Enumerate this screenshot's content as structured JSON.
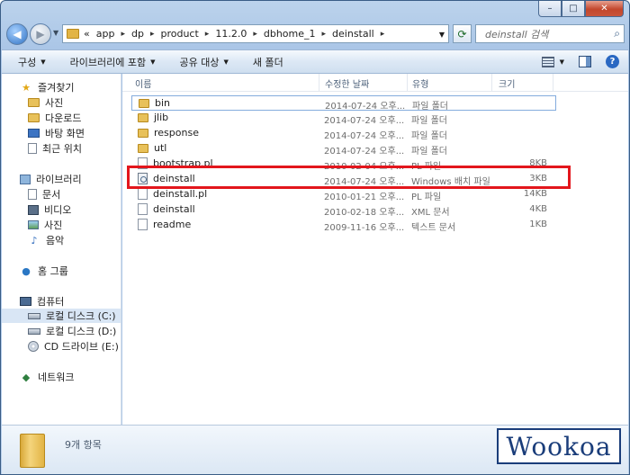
{
  "window": {
    "controls": {
      "minimize": "–",
      "maximize": "□",
      "close": "✕"
    }
  },
  "address_bar": {
    "overflow": "«",
    "crumbs": [
      "app",
      "dp",
      "product",
      "11.2.0",
      "dbhome_1",
      "deinstall"
    ]
  },
  "search": {
    "placeholder": "deinstall 검색"
  },
  "toolbar": {
    "organize": "구성",
    "add_to_library": "라이브러리에 포함",
    "share_with": "공유 대상",
    "new_folder": "새 폴더"
  },
  "sidebar": {
    "favorites": "즐겨찾기",
    "fav_items": [
      "사진",
      "다운로드",
      "바탕 화면",
      "최근 위치"
    ],
    "libraries": "라이브러리",
    "lib_items": [
      "문서",
      "비디오",
      "사진",
      "음악"
    ],
    "homegroup": "홈 그룹",
    "computer": "컴퓨터",
    "drives": [
      "로컬 디스크 (C:)",
      "로컬 디스크 (D:)",
      "CD 드라이브 (E:)"
    ],
    "network": "네트워크"
  },
  "columns": {
    "name": "이름",
    "modified": "수정한 날짜",
    "type": "유형",
    "size": "크기"
  },
  "files": [
    {
      "name": "bin",
      "modified": "2014-07-24 오후...",
      "type": "파일 폴더",
      "size": ""
    },
    {
      "name": "jlib",
      "modified": "2014-07-24 오후...",
      "type": "파일 폴더",
      "size": ""
    },
    {
      "name": "response",
      "modified": "2014-07-24 오후...",
      "type": "파일 폴더",
      "size": ""
    },
    {
      "name": "utl",
      "modified": "2014-07-24 오후...",
      "type": "파일 폴더",
      "size": ""
    },
    {
      "name": "bootstrap.pl",
      "modified": "2010-02-04 오후...",
      "type": "PL 파일",
      "size": "8KB"
    },
    {
      "name": "deinstall",
      "modified": "2014-07-24 오후...",
      "type": "Windows 배치 파일",
      "size": "3KB"
    },
    {
      "name": "deinstall.pl",
      "modified": "2010-01-21 오후...",
      "type": "PL 파일",
      "size": "14KB"
    },
    {
      "name": "deinstall",
      "modified": "2010-02-18 오후...",
      "type": "XML 문서",
      "size": "4KB"
    },
    {
      "name": "readme",
      "modified": "2009-11-16 오후...",
      "type": "텍스트 문서",
      "size": "1KB"
    }
  ],
  "status": {
    "item_count": "9개 항목"
  },
  "watermark": "Wookoa",
  "colors": {
    "highlight_box": "#e3161c",
    "selected_nav": "#d9e6f5"
  }
}
